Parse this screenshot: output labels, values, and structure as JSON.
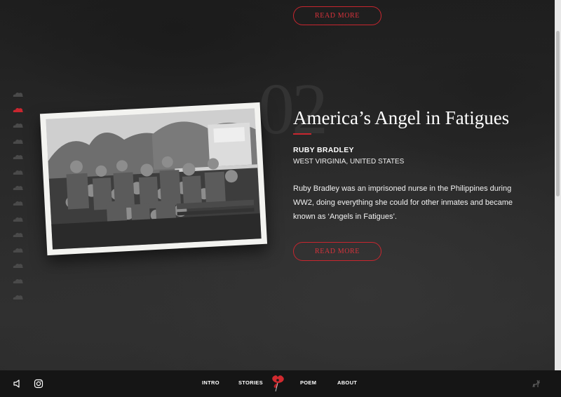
{
  "story": {
    "number": "02",
    "title": "America’s Angel in Fatigues",
    "name": "RUBY BRADLEY",
    "location": "WEST VIRGINIA, UNITED STATES",
    "description": "Ruby Bradley was an imprisoned nurse in the Philippines during WW2, doing everything she could for other inmates and became known as ‘Angels in Fatigues’.",
    "read_more": "READ MORE"
  },
  "prev_story": {
    "read_more": "READ MORE"
  },
  "nav_dots": [
    {
      "label": "story-1",
      "active": false
    },
    {
      "label": "story-2",
      "active": true
    },
    {
      "label": "story-3",
      "active": false
    },
    {
      "label": "story-4",
      "active": false
    },
    {
      "label": "story-5",
      "active": false
    },
    {
      "label": "story-6",
      "active": false
    },
    {
      "label": "story-7",
      "active": false
    },
    {
      "label": "story-8",
      "active": false
    },
    {
      "label": "story-9",
      "active": false
    },
    {
      "label": "story-10",
      "active": false
    },
    {
      "label": "story-11",
      "active": false
    },
    {
      "label": "story-12",
      "active": false
    },
    {
      "label": "story-13",
      "active": false
    },
    {
      "label": "story-14",
      "active": false
    }
  ],
  "footer": {
    "nav": [
      "INTRO",
      "STORIES",
      "POEM",
      "ABOUT"
    ],
    "icons": [
      "speaker-icon",
      "instagram-icon",
      "poppy-logo-icon",
      "deer-icon"
    ]
  },
  "colors": {
    "accent": "#c8262f",
    "footer_bg": "#151515",
    "dot_inactive": "#4a4a4a"
  }
}
